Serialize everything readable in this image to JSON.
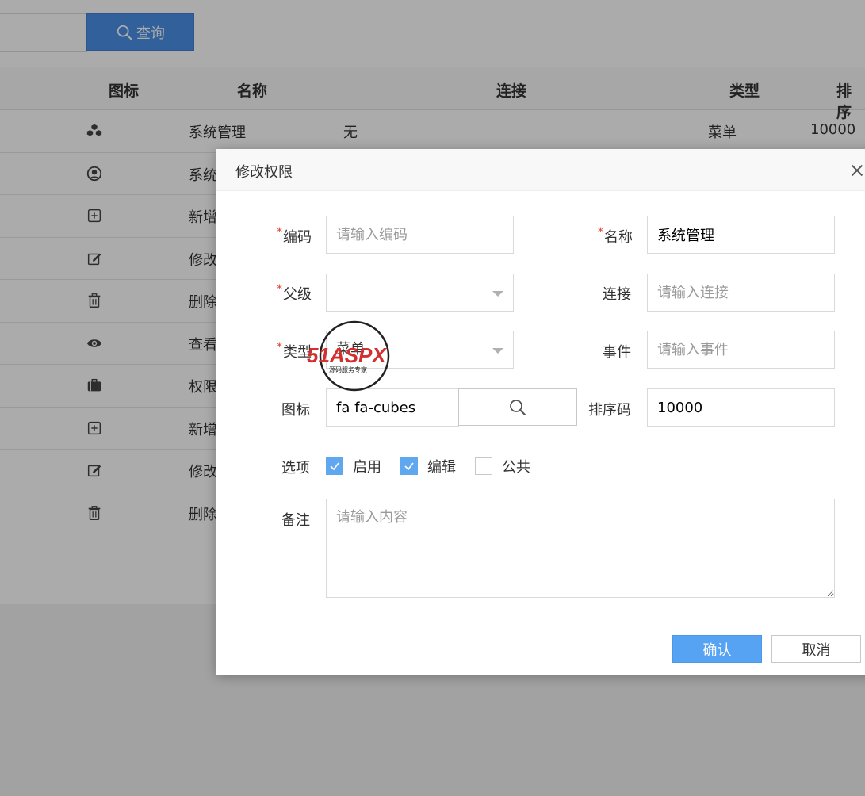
{
  "toolbar": {
    "query_label": "查询",
    "query_icon": "search-icon"
  },
  "table": {
    "headers": {
      "icon": "图标",
      "name": "名称",
      "link": "连接",
      "type": "类型",
      "sort": "排序"
    },
    "rows": [
      {
        "icon": "cubes-icon",
        "name": "系统管理",
        "link": "无",
        "type": "菜单",
        "sort": "10000"
      },
      {
        "icon": "user-circle-icon",
        "name": "系统"
      },
      {
        "icon": "plus-square-icon",
        "name": "新增"
      },
      {
        "icon": "edit-icon",
        "name": "修改"
      },
      {
        "icon": "trash-icon",
        "name": "删除"
      },
      {
        "icon": "eye-icon",
        "name": "查看"
      },
      {
        "icon": "briefcase-icon",
        "name": "权限"
      },
      {
        "icon": "plus-square-icon",
        "name": "新增"
      },
      {
        "icon": "edit-icon",
        "name": "修改"
      },
      {
        "icon": "trash-icon",
        "name": "删除"
      }
    ]
  },
  "modal": {
    "title": "修改权限",
    "code": {
      "label": "编码",
      "required": "*",
      "value": "",
      "placeholder": "请输入编码"
    },
    "name": {
      "label": "名称",
      "required": "*",
      "value": "系统管理",
      "placeholder": ""
    },
    "parent": {
      "label": "父级",
      "required": "*",
      "value": ""
    },
    "link": {
      "label": "连接",
      "value": "",
      "placeholder": "请输入连接"
    },
    "type": {
      "label": "类型",
      "required": "*",
      "value": "菜单"
    },
    "event": {
      "label": "事件",
      "value": "",
      "placeholder": "请输入事件"
    },
    "icon": {
      "label": "图标",
      "value": "fa fa-cubes"
    },
    "sort": {
      "label": "排序码",
      "value": "10000"
    },
    "options": {
      "label": "选项",
      "items": [
        {
          "label": "启用",
          "checked": true
        },
        {
          "label": "编辑",
          "checked": true
        },
        {
          "label": "公共",
          "checked": false
        }
      ]
    },
    "remark": {
      "label": "备注",
      "placeholder": "请输入内容"
    },
    "confirm_label": "确认",
    "cancel_label": "取消"
  },
  "watermark": {
    "brand": "51ASPX",
    "tagline": "源码服务专家"
  },
  "colors": {
    "primary": "#4a8fe7",
    "confirm": "#57a3f3",
    "checked": "#5fa8ef",
    "required": "#e0422f"
  }
}
